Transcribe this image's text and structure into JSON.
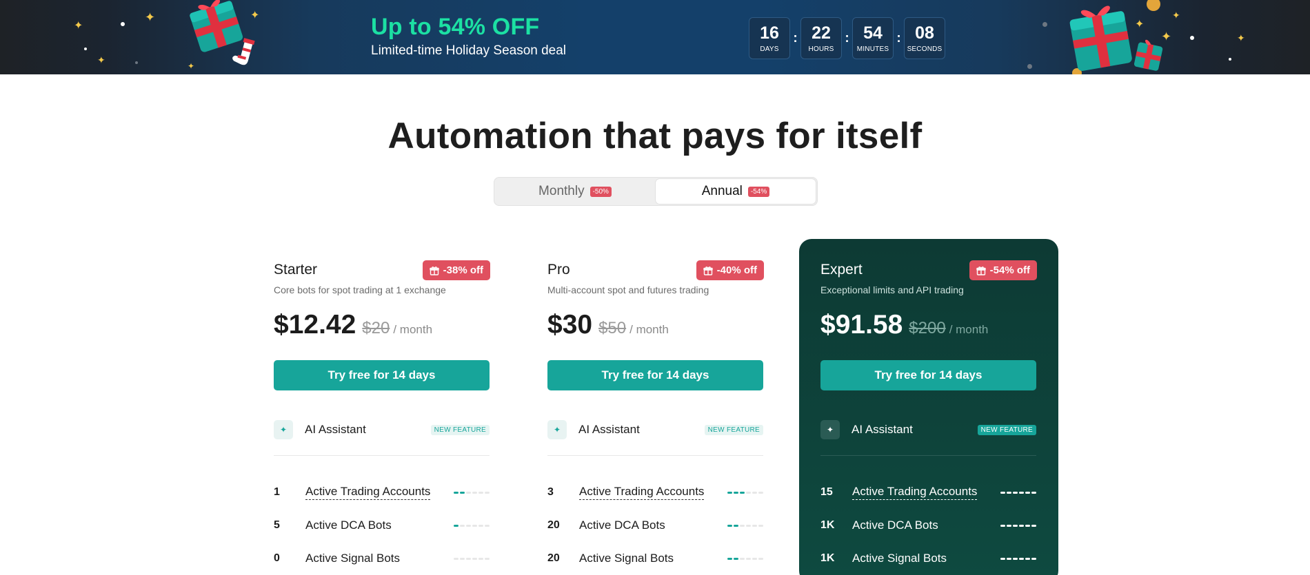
{
  "banner": {
    "headline": "Up to 54% OFF",
    "subline": "Limited-time Holiday Season deal",
    "countdown": [
      {
        "value": "16",
        "label": "DAYS"
      },
      {
        "value": "22",
        "label": "HOURS"
      },
      {
        "value": "54",
        "label": "MINUTES"
      },
      {
        "value": "08",
        "label": "SECONDS"
      }
    ],
    "separator": ":"
  },
  "heading": "Automation that pays for itself",
  "billing_toggle": {
    "monthly": {
      "label": "Monthly",
      "badge": "-50%"
    },
    "annual": {
      "label": "Annual",
      "badge": "-54%",
      "selected": true
    }
  },
  "plans": [
    {
      "name": "Starter",
      "discount": "-38% off",
      "description": "Core bots for spot trading at 1 exchange",
      "price": "$12.42",
      "old_price": "$20",
      "period": "/ month",
      "cta": "Try free for 14 days",
      "ai": {
        "label": "AI Assistant",
        "badge": "NEW FEATURE"
      },
      "features": [
        {
          "count": "1",
          "label": "Active Trading Accounts",
          "level": 2
        },
        {
          "count": "5",
          "label": "Active DCA Bots",
          "level": 1
        },
        {
          "count": "0",
          "label": "Active Signal Bots",
          "level": 0
        }
      ]
    },
    {
      "name": "Pro",
      "discount": "-40% off",
      "description": "Multi-account spot and futures trading",
      "price": "$30",
      "old_price": "$50",
      "period": "/ month",
      "cta": "Try free for 14 days",
      "ai": {
        "label": "AI Assistant",
        "badge": "NEW FEATURE"
      },
      "features": [
        {
          "count": "3",
          "label": "Active Trading Accounts",
          "level": 3
        },
        {
          "count": "20",
          "label": "Active DCA Bots",
          "level": 2
        },
        {
          "count": "20",
          "label": "Active Signal Bots",
          "level": 2
        }
      ]
    },
    {
      "name": "Expert",
      "discount": "-54% off",
      "description": "Exceptional limits and API trading",
      "price": "$91.58",
      "old_price": "$200",
      "period": "/ month",
      "cta": "Try free for 14 days",
      "ai": {
        "label": "AI Assistant",
        "badge": "NEW FEATURE"
      },
      "features": [
        {
          "count": "15",
          "label": "Active Trading Accounts",
          "level": 6
        },
        {
          "count": "1K",
          "label": "Active DCA Bots",
          "level": 6
        },
        {
          "count": "1K",
          "label": "Active Signal Bots",
          "level": 6
        }
      ]
    }
  ],
  "colors": {
    "accent": "#17a59a",
    "discount_red": "#e0505f",
    "expert_bg": "#0d3a34",
    "promo_green": "#1ce0a3"
  }
}
